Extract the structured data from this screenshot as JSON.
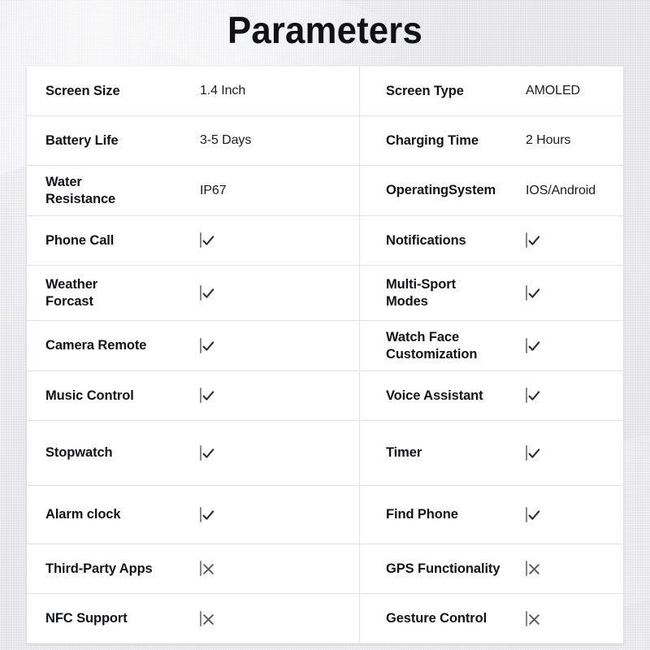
{
  "page": {
    "title": "Parameters",
    "background_color": "#ebebec",
    "table_background": "#ffffff",
    "divider_color": "#e2e2e4",
    "text_color": "#131417",
    "checkbox_border_color": "#86868b"
  },
  "icons": {
    "check": "check-icon",
    "cross": "cross-icon"
  },
  "rows": [
    {
      "left": {
        "label": "Screen Size",
        "type": "text",
        "value": "1.4 Inch"
      },
      "right": {
        "label": "Screen Type",
        "type": "text",
        "value": "AMOLED"
      }
    },
    {
      "left": {
        "label": "Battery Life",
        "type": "text",
        "value": "3-5 Days"
      },
      "right": {
        "label": "Charging Time",
        "type": "text",
        "value": "2 Hours"
      }
    },
    {
      "left": {
        "label": "Water\nResistance",
        "type": "text",
        "value": "IP67"
      },
      "right": {
        "label": "OperatingSystem",
        "type": "text",
        "value": "IOS/Android"
      }
    },
    {
      "left": {
        "label": "Phone Call",
        "type": "check",
        "value": "checked"
      },
      "right": {
        "label": "Notifications",
        "type": "check",
        "value": "checked"
      }
    },
    {
      "left": {
        "label": "Weather\nForcast",
        "type": "check",
        "value": "checked"
      },
      "right": {
        "label": "Multi-Sport\nModes",
        "type": "check",
        "value": "checked"
      }
    },
    {
      "left": {
        "label": "Camera Remote",
        "type": "check",
        "value": "checked"
      },
      "right": {
        "label": "Watch Face\nCustomization",
        "type": "check",
        "value": "checked"
      }
    },
    {
      "left": {
        "label": "Music Control",
        "type": "check",
        "value": "checked"
      },
      "right": {
        "label": "Voice Assistant",
        "type": "check",
        "value": "checked"
      }
    },
    {
      "left": {
        "label": "Stopwatch",
        "type": "check",
        "value": "checked"
      },
      "right": {
        "label": "Timer",
        "type": "check",
        "value": "checked"
      }
    },
    {
      "left": {
        "label": "Alarm clock",
        "type": "check",
        "value": "checked"
      },
      "right": {
        "label": "Find Phone",
        "type": "check",
        "value": "checked"
      }
    },
    {
      "left": {
        "label": "Third-Party Apps",
        "type": "cross",
        "value": "unchecked"
      },
      "right": {
        "label": "GPS Functionality",
        "type": "cross",
        "value": "unchecked"
      }
    },
    {
      "left": {
        "label": "NFC Support",
        "type": "cross",
        "value": "unchecked"
      },
      "right": {
        "label": "Gesture Control",
        "type": "cross",
        "value": "unchecked"
      }
    }
  ]
}
